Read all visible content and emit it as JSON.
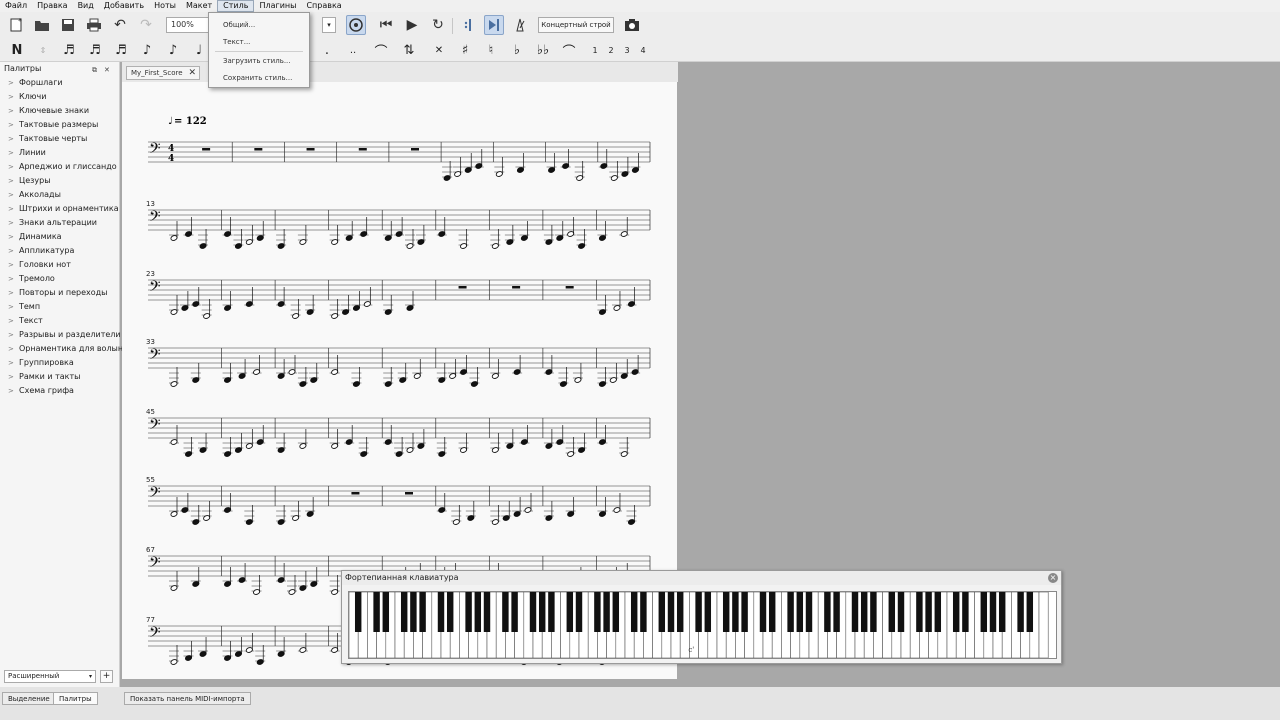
{
  "menubar": [
    "Файл",
    "Правка",
    "Вид",
    "Добавить",
    "Ноты",
    "Макет",
    "Стиль",
    "Плагины",
    "Справка"
  ],
  "style_menu": {
    "items": [
      "Общий...",
      "Текст...",
      "Загрузить стиль...",
      "Сохранить стиль..."
    ]
  },
  "toolbar": {
    "zoom": "100%",
    "concert_pitch": "Концертный строй"
  },
  "note_toolbar": {
    "voices": [
      "1",
      "2",
      "3",
      "4"
    ]
  },
  "palette": {
    "title": "Палитры",
    "items": [
      "Форшлаги",
      "Ключи",
      "Ключевые знаки",
      "Тактовые размеры",
      "Тактовые черты",
      "Линии",
      "Арпеджио и глиссандо",
      "Цезуры",
      "Акколады",
      "Штрихи и орнаментика",
      "Знаки альтерации",
      "Динамика",
      "Аппликатура",
      "Головки нот",
      "Тремоло",
      "Повторы и переходы",
      "Темп",
      "Текст",
      "Разрывы и разделители",
      "Орнаментика для волынки",
      "Группировка",
      "Рамки и такты",
      "Схема грифа"
    ],
    "workspace": "Расширенный"
  },
  "score_tab": "My_First_Score",
  "score": {
    "tempo": "= 122",
    "systems": [
      {
        "measure": ""
      },
      {
        "measure": "13"
      },
      {
        "measure": "23"
      },
      {
        "measure": "33"
      },
      {
        "measure": "45"
      },
      {
        "measure": "55"
      },
      {
        "measure": "67"
      },
      {
        "measure": "77"
      }
    ]
  },
  "piano": {
    "title": "Фортепианная клавиатура",
    "middle_c": "c'"
  },
  "bottom_tabs": [
    "Выделение",
    "Палитры"
  ],
  "midi_button": "Показать панель MIDI-импорта"
}
